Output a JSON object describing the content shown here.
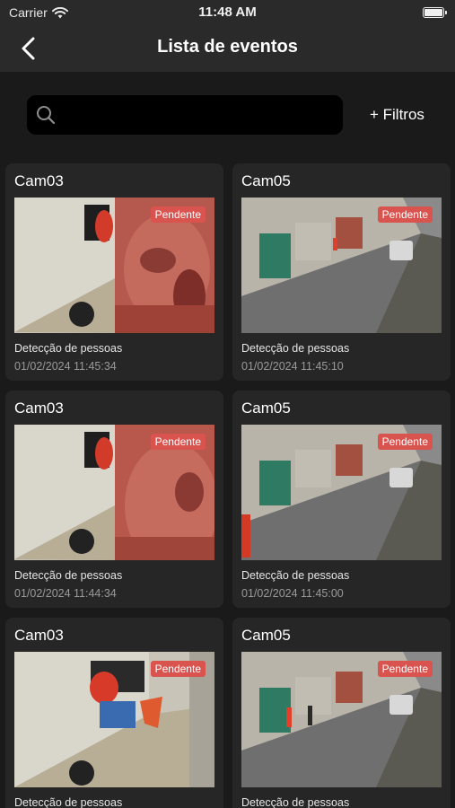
{
  "status_bar": {
    "carrier": "Carrier",
    "time": "11:48 AM",
    "icons": [
      "wifi-icon",
      "battery-icon"
    ]
  },
  "nav": {
    "title": "Lista de eventos",
    "back_icon": "chevron-left-icon"
  },
  "search": {
    "placeholder": "",
    "value": "",
    "icon": "search-icon"
  },
  "filters_label": "+ Filtros",
  "colors": {
    "background": "#1a1a1a",
    "bar": "#2a2a2a",
    "card": "#262626",
    "badge": "#d9534f",
    "search_box": "#000000"
  },
  "events": [
    {
      "camera": "Cam03",
      "status": "Pendente",
      "type": "Detecção de pessoas",
      "datetime": "01/02/2024 11:45:34",
      "scene": "indoor-face"
    },
    {
      "camera": "Cam05",
      "status": "Pendente",
      "type": "Detecção de pessoas",
      "datetime": "01/02/2024 11:45:10",
      "scene": "street"
    },
    {
      "camera": "Cam03",
      "status": "Pendente",
      "type": "Detecção de pessoas",
      "datetime": "01/02/2024 11:44:34",
      "scene": "indoor-face"
    },
    {
      "camera": "Cam05",
      "status": "Pendente",
      "type": "Detecção de pessoas",
      "datetime": "01/02/2024 11:45:00",
      "scene": "street"
    },
    {
      "camera": "Cam03",
      "status": "Pendente",
      "type": "Detecção de pessoas",
      "datetime": "",
      "scene": "indoor"
    },
    {
      "camera": "Cam05",
      "status": "Pendente",
      "type": "Detecção de pessoas",
      "datetime": "",
      "scene": "street"
    }
  ]
}
